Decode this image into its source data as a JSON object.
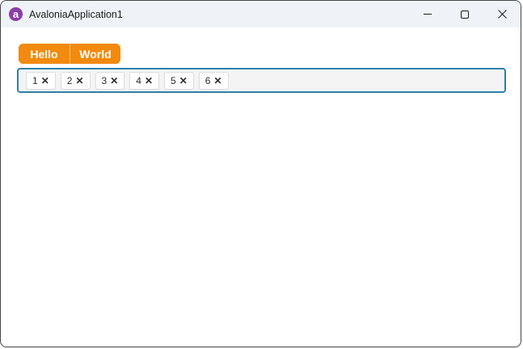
{
  "window": {
    "title": "AvaloniaApplication1",
    "logo_letter": "a",
    "titlebar_bg": "#EFF3F8",
    "controls": {
      "minimize": "minimize-icon",
      "maximize": "maximize-icon",
      "close": "close-icon"
    }
  },
  "toolbar": {
    "accent_color": "#F28A0E",
    "buttons": [
      {
        "label": "Hello"
      },
      {
        "label": "World"
      }
    ]
  },
  "tags_input": {
    "focus_border_color": "#2F7FA8",
    "background": "#F4F4F4",
    "remove_glyph": "✕",
    "tags": [
      {
        "label": "1"
      },
      {
        "label": "2"
      },
      {
        "label": "3"
      },
      {
        "label": "4"
      },
      {
        "label": "5"
      },
      {
        "label": "6"
      }
    ]
  }
}
